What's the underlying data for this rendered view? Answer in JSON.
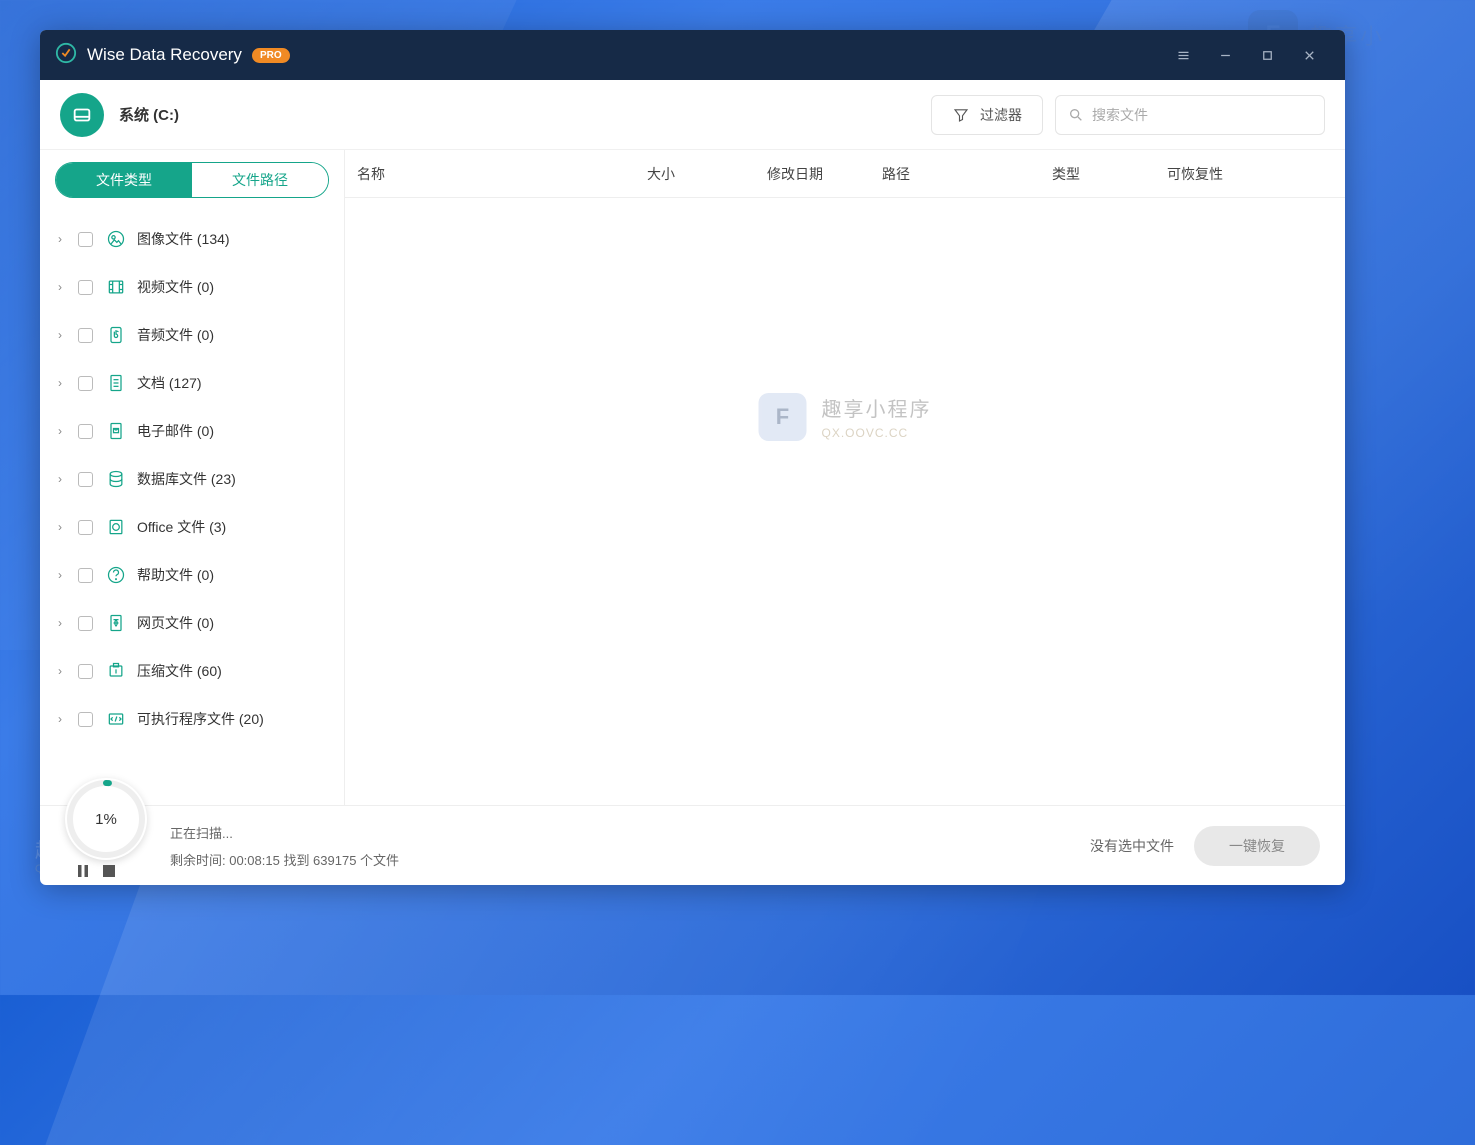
{
  "titlebar": {
    "appName": "Wise Data Recovery",
    "badge": "PRO"
  },
  "subheader": {
    "driveLabel": "系统 (C:)",
    "filterLabel": "过滤器",
    "searchPlaceholder": "搜索文件"
  },
  "tabs": {
    "byType": "文件类型",
    "byPath": "文件路径"
  },
  "categories": [
    {
      "key": "image",
      "label": "图像文件 (134)"
    },
    {
      "key": "video",
      "label": "视频文件 (0)"
    },
    {
      "key": "audio",
      "label": "音频文件 (0)"
    },
    {
      "key": "doc",
      "label": "文档 (127)"
    },
    {
      "key": "email",
      "label": "电子邮件 (0)"
    },
    {
      "key": "db",
      "label": "数据库文件 (23)"
    },
    {
      "key": "office",
      "label": "Office 文件 (3)"
    },
    {
      "key": "help",
      "label": "帮助文件 (0)"
    },
    {
      "key": "web",
      "label": "网页文件 (0)"
    },
    {
      "key": "zip",
      "label": "压缩文件 (60)"
    },
    {
      "key": "exe",
      "label": "可执行程序文件 (20)"
    }
  ],
  "columns": {
    "name": "名称",
    "size": "大小",
    "date": "修改日期",
    "path": "路径",
    "type": "类型",
    "recoverable": "可恢复性"
  },
  "watermark": {
    "title": "趣享小程序",
    "sub": "QX.OOVC.CC"
  },
  "footer": {
    "progressPct": "1%",
    "scanning": "正在扫描...",
    "remaining": "剩余时间: 00:08:15 找到 639175 个文件",
    "noSelection": "没有选中文件",
    "recoverBtn": "一键恢复"
  }
}
